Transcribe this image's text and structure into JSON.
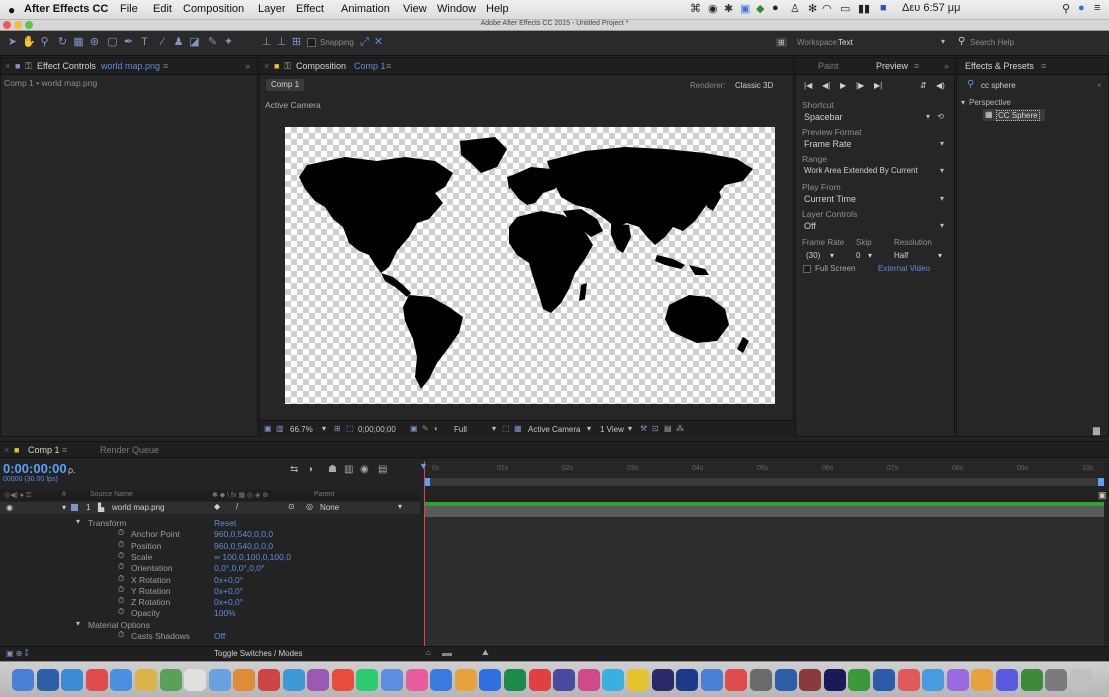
{
  "app": {
    "apple": "",
    "name": "After Effects CC",
    "menus": [
      "File",
      "Edit",
      "Composition",
      "Layer",
      "Effect",
      "Animation",
      "View",
      "Window",
      "Help"
    ],
    "clock": "Δευ 6:57 μμ"
  },
  "window": {
    "title": "Adobe After Effects CC 2015 - Untitled Project *"
  },
  "toolbar": {
    "snapping": "Snapping",
    "workspace_label": "Workspace:",
    "workspace_value": "Text",
    "search_placeholder": "Search Help"
  },
  "effect_controls": {
    "tab_title": "Effect Controls",
    "tab_layer": "world map.png",
    "breadcrumb": "Comp 1 • world map.png"
  },
  "composition": {
    "tab_title": "Composition",
    "tab_comp": "Comp 1",
    "comp_tab": "Comp 1",
    "renderer_label": "Renderer:",
    "renderer_value": "Classic 3D",
    "view_label": "Active Camera",
    "zoom": "66.7%",
    "timecode": "0;00;00;00",
    "resolution": "Full",
    "camera": "Active Camera",
    "views": "1 View"
  },
  "preview": {
    "tab_paint": "Paint",
    "tab_preview": "Preview",
    "shortcut_label": "Shortcut",
    "shortcut_value": "Spacebar",
    "preview_label": "Preview Format",
    "preview_value": "Frame Rate",
    "range_label": "Range",
    "range_value": "Work Area Extended By Current",
    "playfrom_label": "Play From",
    "playfrom_value": "Current Time",
    "layer_controls_label": "Layer Controls",
    "layer_controls_value": "Off",
    "frame_rate_label": "Frame Rate",
    "skip_label": "Skip",
    "resolution_label": "Resolution",
    "frame_rate_value": "(30)",
    "skip_value": "0",
    "resolution_value": "Half",
    "full_screen": "Full Screen",
    "external_video": "External Video"
  },
  "effects": {
    "tab_title": "Effects & Presets",
    "search_value": "cc sphere",
    "category": "Perspective",
    "item": "CC Sphere"
  },
  "timeline": {
    "tab_comp": "Comp 1",
    "tab_render": "Render Queue",
    "timecode": "0:00:00:00",
    "fps": "00000 (30.00 fps)",
    "search_placeholder": "ρ.",
    "col_source": "Source Name",
    "col_parent": "Parent",
    "layer_num": "1",
    "layer_name": "world map.png",
    "parent_value": "None",
    "properties": [
      {
        "name": "Transform",
        "value": "Reset",
        "indent": 0
      },
      {
        "name": "Anchor Point",
        "value": "960,0,540,0,0,0",
        "indent": 1
      },
      {
        "name": "Position",
        "value": "960,0,540,0,0,0",
        "indent": 1
      },
      {
        "name": "Scale",
        "value": "∞ 100,0,100,0,100,0",
        "indent": 1
      },
      {
        "name": "Orientation",
        "value": "0,0°,0,0°,0,0°",
        "indent": 1
      },
      {
        "name": "X Rotation",
        "value": "0x+0,0°",
        "indent": 1
      },
      {
        "name": "Y Rotation",
        "value": "0x+0,0°",
        "indent": 1
      },
      {
        "name": "Z Rotation",
        "value": "0x+0,0°",
        "indent": 1
      },
      {
        "name": "Opacity",
        "value": "100%",
        "indent": 1
      },
      {
        "name": "Material Options",
        "value": "",
        "indent": 0
      },
      {
        "name": "Casts Shadows",
        "value": "Off",
        "indent": 1
      }
    ],
    "ruler": [
      "0s",
      "01s",
      "02s",
      "03s",
      "04s",
      "05s",
      "06s",
      "07s",
      "08s",
      "09s",
      "10s"
    ],
    "toggle": "Toggle Switches / Modes"
  },
  "colors": {
    "accent_blue": "#5a8fe0",
    "timecode": "#5aa0ff",
    "playhead": "#e6c22c",
    "workarea": "#2fa32f"
  }
}
